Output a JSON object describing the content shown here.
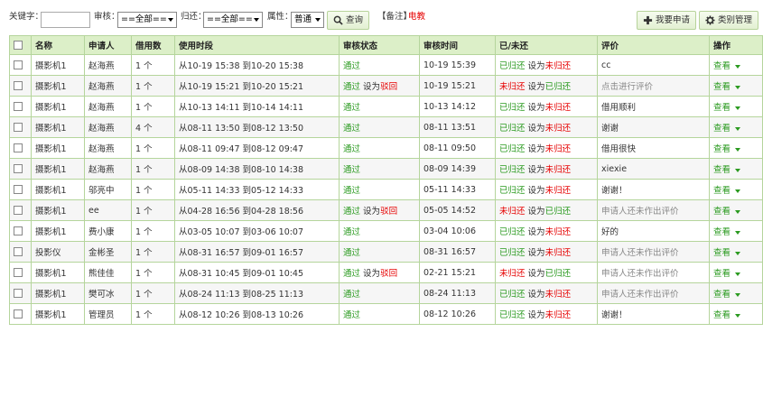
{
  "toolbar": {
    "keyword_label": "关键字：",
    "keyword_value": "",
    "audit_label": "审核：",
    "audit_value": "==全部==",
    "return_label": "归还：",
    "return_value": "==全部==",
    "attr_label": "属性：",
    "attr_value": "普通",
    "query_label": "查询",
    "note_label": "【备注】",
    "note_value": "电教",
    "apply_label": "我要申请",
    "category_label": "类别管理"
  },
  "columns": [
    "名称",
    "申请人",
    "借用数",
    "使用时段",
    "审核状态",
    "审核时间",
    "已/未还",
    "评价",
    "操作"
  ],
  "rows": [
    {
      "name": "摄影机1",
      "applicant": "赵海燕",
      "count": "1 个",
      "period": "从10-19 15:38 到10-20 15:38",
      "status": "通过",
      "status_extra": "",
      "audit_time": "10-19 15:39",
      "ret_state": "已归还",
      "ret_set": "未归还",
      "comment": "cc",
      "comment_muted": false,
      "op": "查看"
    },
    {
      "name": "摄影机1",
      "applicant": "赵海燕",
      "count": "1 个",
      "period": "从10-19 15:21 到10-20 15:21",
      "status": "通过",
      "status_extra": "驳回",
      "audit_time": "10-19 15:21",
      "ret_state": "未归还",
      "ret_set": "已归还",
      "comment": "点击进行评价",
      "comment_muted": true,
      "op": "查看"
    },
    {
      "name": "摄影机1",
      "applicant": "赵海燕",
      "count": "1 个",
      "period": "从10-13 14:11 到10-14 14:11",
      "status": "通过",
      "status_extra": "",
      "audit_time": "10-13 14:12",
      "ret_state": "已归还",
      "ret_set": "未归还",
      "comment": "借用顺利",
      "comment_muted": false,
      "op": "查看"
    },
    {
      "name": "摄影机1",
      "applicant": "赵海燕",
      "count": "4 个",
      "period": "从08-11 13:50 到08-12 13:50",
      "status": "通过",
      "status_extra": "",
      "audit_time": "08-11 13:51",
      "ret_state": "已归还",
      "ret_set": "未归还",
      "comment": "谢谢",
      "comment_muted": false,
      "op": "查看"
    },
    {
      "name": "摄影机1",
      "applicant": "赵海燕",
      "count": "1 个",
      "period": "从08-11 09:47 到08-12 09:47",
      "status": "通过",
      "status_extra": "",
      "audit_time": "08-11 09:50",
      "ret_state": "已归还",
      "ret_set": "未归还",
      "comment": "借用很快",
      "comment_muted": false,
      "op": "查看"
    },
    {
      "name": "摄影机1",
      "applicant": "赵海燕",
      "count": "1 个",
      "period": "从08-09 14:38 到08-10 14:38",
      "status": "通过",
      "status_extra": "",
      "audit_time": "08-09 14:39",
      "ret_state": "已归还",
      "ret_set": "未归还",
      "comment": "xiexie",
      "comment_muted": false,
      "op": "查看"
    },
    {
      "name": "摄影机1",
      "applicant": "邬亮中",
      "count": "1 个",
      "period": "从05-11 14:33 到05-12 14:33",
      "status": "通过",
      "status_extra": "",
      "audit_time": "05-11 14:33",
      "ret_state": "已归还",
      "ret_set": "未归还",
      "comment": "谢谢！",
      "comment_muted": false,
      "op": "查看"
    },
    {
      "name": "摄影机1",
      "applicant": "ee",
      "count": "1 个",
      "period": "从04-28 16:56 到04-28 18:56",
      "status": "通过",
      "status_extra": "驳回",
      "audit_time": "05-05 14:52",
      "ret_state": "未归还",
      "ret_set": "已归还",
      "comment": "申请人还未作出评价",
      "comment_muted": true,
      "op": "查看"
    },
    {
      "name": "摄影机1",
      "applicant": "费小康",
      "count": "1 个",
      "period": "从03-05 10:07 到03-06 10:07",
      "status": "通过",
      "status_extra": "",
      "audit_time": "03-04 10:06",
      "ret_state": "已归还",
      "ret_set": "未归还",
      "comment": "好的",
      "comment_muted": false,
      "op": "查看"
    },
    {
      "name": "投影仪",
      "applicant": "金彬圣",
      "count": "1 个",
      "period": "从08-31 16:57 到09-01 16:57",
      "status": "通过",
      "status_extra": "",
      "audit_time": "08-31 16:57",
      "ret_state": "已归还",
      "ret_set": "未归还",
      "comment": "申请人还未作出评价",
      "comment_muted": true,
      "op": "查看"
    },
    {
      "name": "摄影机1",
      "applicant": "熊佳佳",
      "count": "1 个",
      "period": "从08-31 10:45 到09-01 10:45",
      "status": "通过",
      "status_extra": "驳回",
      "audit_time": "02-21 15:21",
      "ret_state": "未归还",
      "ret_set": "已归还",
      "comment": "申请人还未作出评价",
      "comment_muted": true,
      "op": "查看"
    },
    {
      "name": "摄影机1",
      "applicant": "樊可冰",
      "count": "1 个",
      "period": "从08-24 11:13 到08-25 11:13",
      "status": "通过",
      "status_extra": "",
      "audit_time": "08-24 11:13",
      "ret_state": "已归还",
      "ret_set": "未归还",
      "comment": "申请人还未作出评价",
      "comment_muted": true,
      "op": "查看"
    },
    {
      "name": "摄影机1",
      "applicant": "管理员",
      "count": "1 个",
      "period": "从08-12 10:26 到08-13 10:26",
      "status": "通过",
      "status_extra": "",
      "audit_time": "08-12 10:26",
      "ret_state": "已归还",
      "ret_set": "未归还",
      "comment": "谢谢！",
      "comment_muted": false,
      "op": "查看"
    }
  ],
  "row_labels": {
    "set_as": "设为"
  },
  "colors": {
    "accent_green": "#2a9a1f",
    "alert_red": "#e60000",
    "header_bg": "#dcefc8",
    "border": "#b5d59c"
  }
}
